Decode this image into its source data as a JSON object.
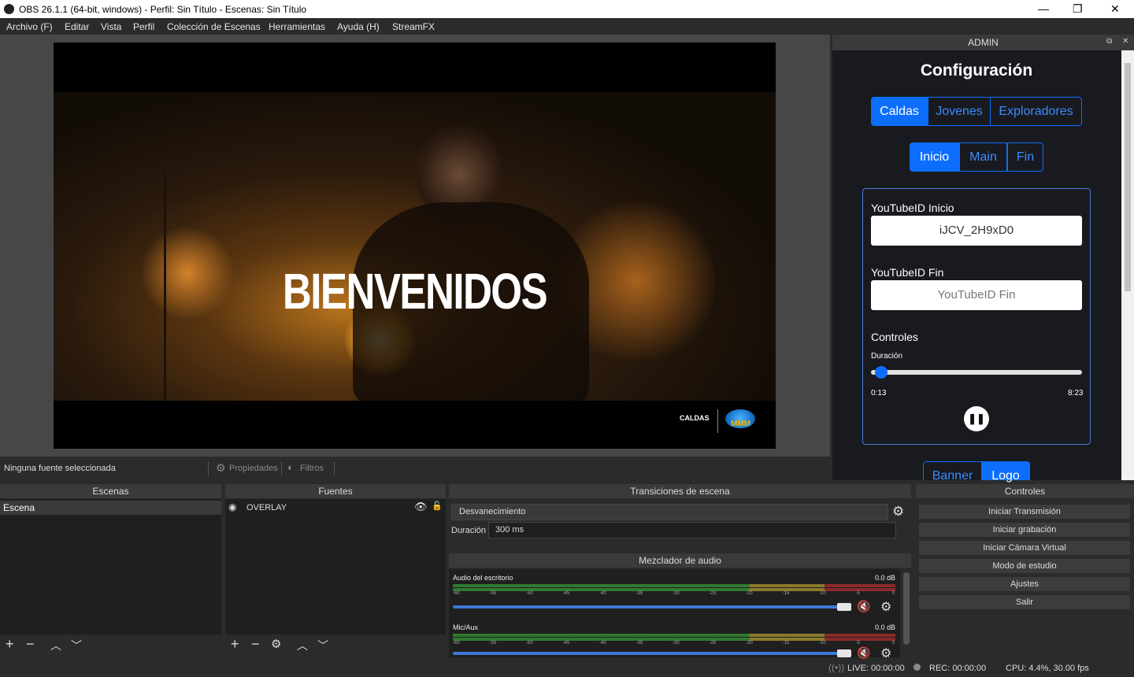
{
  "window": {
    "title": "OBS 26.1.1 (64-bit, windows) - Perfil: Sin Título - Escenas: Sin Título",
    "minimize": "—",
    "maximize": "❐",
    "close": "✕"
  },
  "menu": [
    "Archivo (F)",
    "Editar",
    "Vista",
    "Perfil",
    "Colección de Escenas",
    "Herramientas",
    "Ayuda (H)",
    "StreamFX"
  ],
  "preview": {
    "overlay_text": "BIENVENIDOS",
    "logo_left": "CALDAS",
    "logo_right": "MMM"
  },
  "source_bar": {
    "none_selected": "Ninguna fuente seleccionada",
    "properties": "Propiedades",
    "filters": "Filtros"
  },
  "admin": {
    "dock_title": "ADMIN",
    "heading": "Configuración",
    "group_tabs": [
      "Caldas",
      "Jovenes",
      "Exploradores"
    ],
    "section_tabs": [
      "Inicio",
      "Main",
      "Fin"
    ],
    "youtube_inicio_label": "YouTubeID Inicio",
    "youtube_inicio_value": "iJCV_2H9xD0",
    "youtube_fin_label": "YouTubeID Fin",
    "youtube_fin_placeholder": "YouTubeID Fin",
    "controls_label": "Controles",
    "duration_label": "Duración",
    "time_current": "0:13",
    "time_total": "8:23",
    "progress": 0.026,
    "bottom_tabs": [
      "Banner",
      "Logo"
    ]
  },
  "scenes": {
    "title": "Escenas",
    "items": [
      "Escena"
    ]
  },
  "sources": {
    "title": "Fuentes",
    "items": [
      "OVERLAY"
    ]
  },
  "transitions": {
    "title": "Transiciones de escena",
    "selected": "Desvanecimiento",
    "duration_label": "Duración",
    "duration_value": "300 ms"
  },
  "mixer": {
    "title": "Mezclador de audio",
    "channels": [
      {
        "name": "Audio del escritorio",
        "db": "0.0 dB"
      },
      {
        "name": "Mic/Aux",
        "db": "0.0 dB"
      }
    ],
    "ticks": [
      "-60",
      "-55",
      "-50",
      "-45",
      "-40",
      "-35",
      "-30",
      "-25",
      "-20",
      "-15",
      "-10",
      "-5",
      "0"
    ]
  },
  "controls": {
    "title": "Controles",
    "buttons": [
      "Iniciar Transmisión",
      "Iniciar grabación",
      "Iniciar Cámara Virtual",
      "Modo de estudio",
      "Ajustes",
      "Salir"
    ]
  },
  "status": {
    "live": "LIVE: 00:00:00",
    "rec": "REC: 00:00:00",
    "cpu": "CPU: 4.4%, 30.00 fps"
  }
}
